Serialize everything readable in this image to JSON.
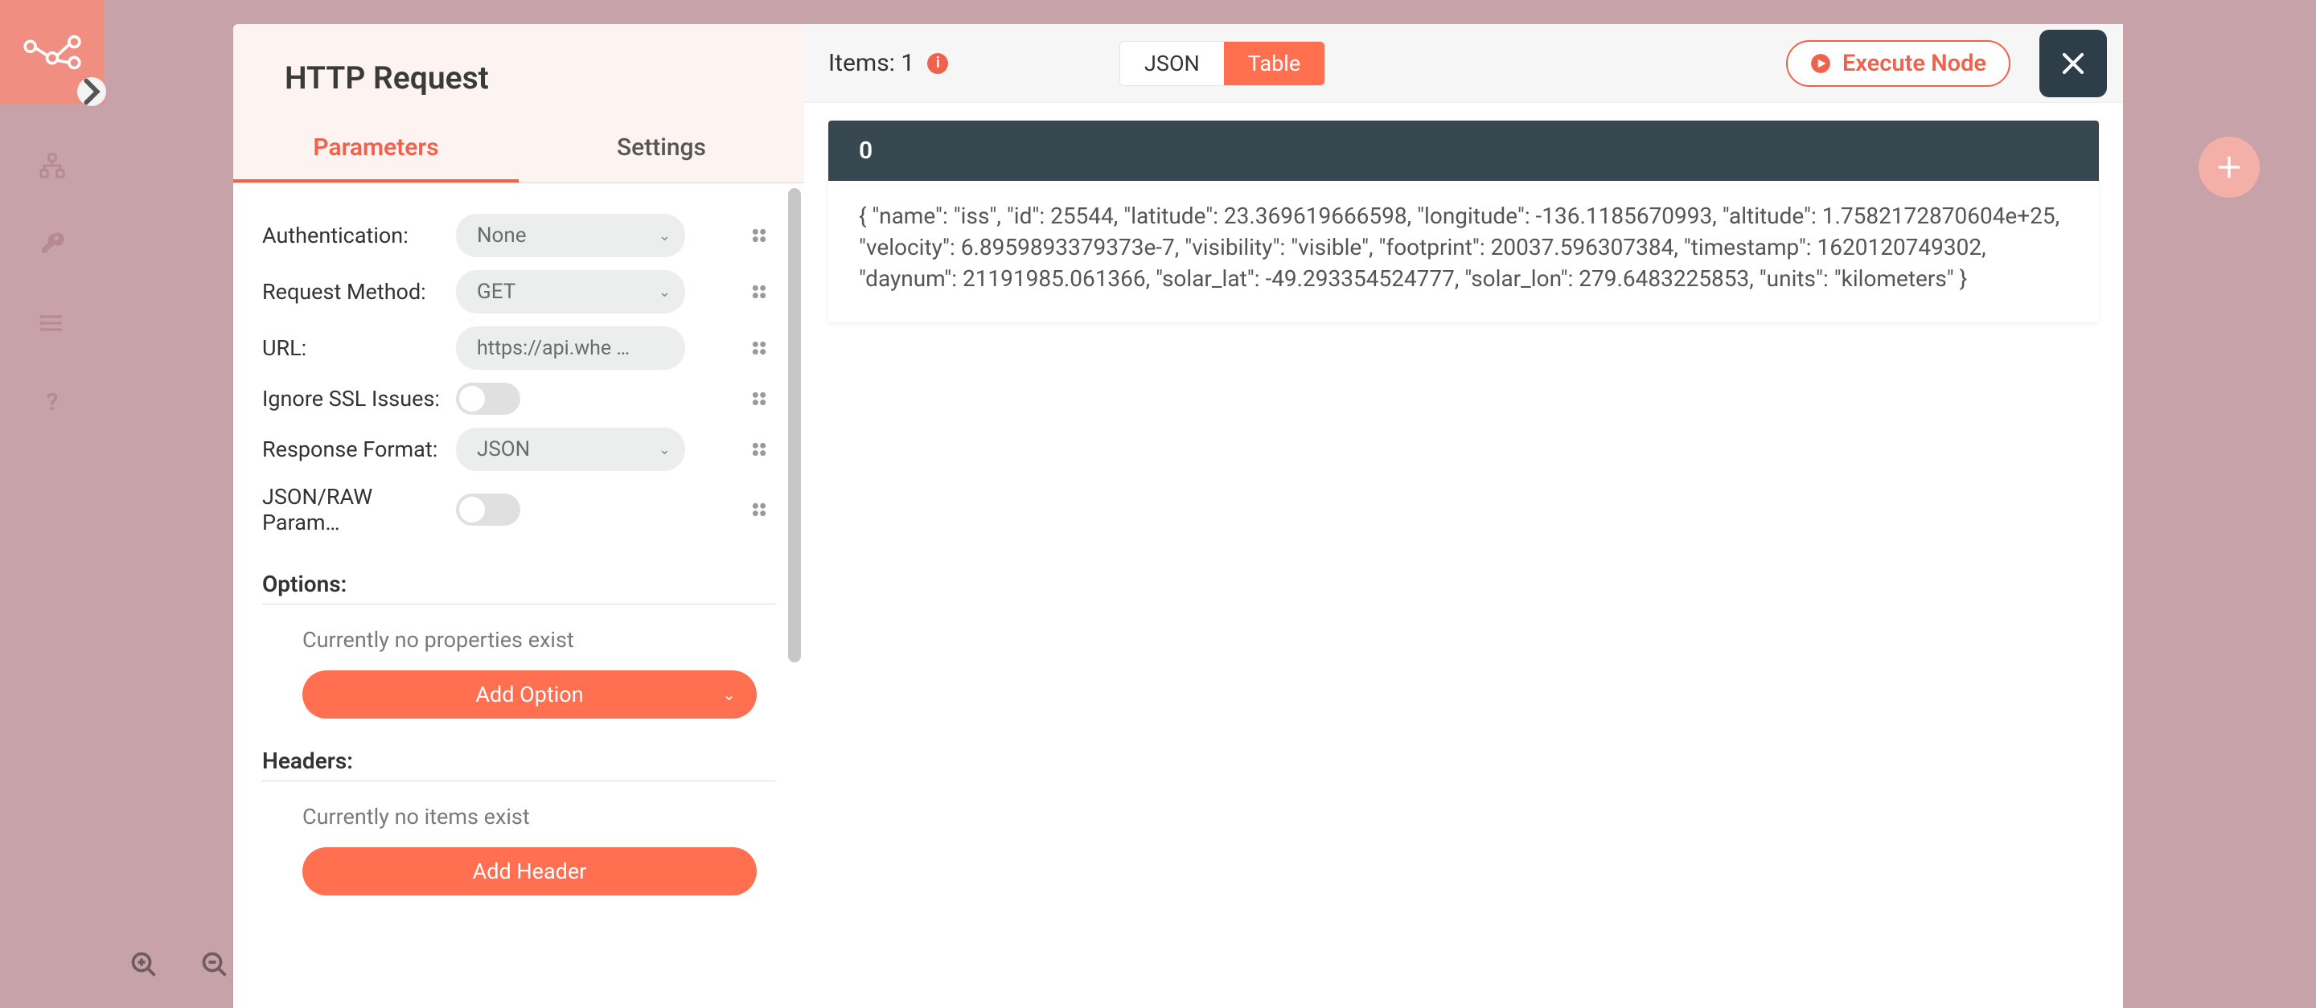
{
  "modal": {
    "title": "HTTP Request",
    "tabs": {
      "parameters": "Parameters",
      "settings": "Settings"
    }
  },
  "params": {
    "authentication": {
      "label": "Authentication:",
      "value": "None"
    },
    "request_method": {
      "label": "Request Method:",
      "value": "GET"
    },
    "url": {
      "label": "URL:",
      "value": "https://api.whe …"
    },
    "ignore_ssl": {
      "label": "Ignore SSL Issues:"
    },
    "response_format": {
      "label": "Response Format:",
      "value": "JSON"
    },
    "json_raw": {
      "label": "JSON/RAW Param…"
    }
  },
  "options": {
    "title": "Options:",
    "empty": "Currently no properties exist",
    "button": "Add Option"
  },
  "headers": {
    "title": "Headers:",
    "empty": "Currently no items exist",
    "button": "Add Header"
  },
  "right": {
    "items_label": "Items: 1",
    "seg_json": "JSON",
    "seg_table": "Table",
    "execute": "Execute Node",
    "index": "0",
    "body": "{ \"name\": \"iss\", \"id\": 25544, \"latitude\": 23.369619666598, \"longitude\": -136.1185670993, \"altitude\": 1.7582172870604e+25, \"velocity\": 6.8959893379373e-7, \"visibility\": \"visible\", \"footprint\": 20037.596307384, \"timestamp\": 1620120749302, \"daynum\": 21191985.061366, \"solar_lat\": -49.293354524777, \"solar_lon\": 279.6483225853, \"units\": \"kilometers\" }"
  }
}
